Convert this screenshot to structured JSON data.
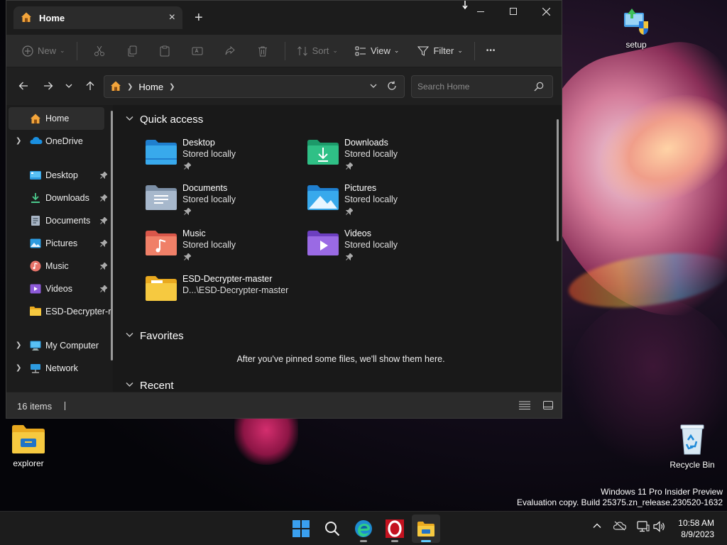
{
  "desktop": {
    "icons": [
      {
        "label": "setup"
      },
      {
        "label": "explorer"
      },
      {
        "label": "Recycle Bin"
      }
    ],
    "watermark_line1": "Windows 11 Pro Insider Preview",
    "watermark_line2": "Evaluation copy. Build 25375.zn_release.230520-1632"
  },
  "window": {
    "tab_title": "Home",
    "tab_close": "×",
    "new_tab": "+",
    "controls": {
      "minimize": "─",
      "maximize": "☐",
      "close": "✕"
    },
    "toolbar": {
      "new_label": "New",
      "sort_label": "Sort",
      "view_label": "View",
      "filter_label": "Filter",
      "more_label": "•••"
    },
    "address": {
      "crumbs": [
        "Home"
      ],
      "search_placeholder": "Search Home"
    },
    "nav": {
      "items": [
        {
          "label": "Home",
          "icon": "home-icon",
          "selected": true
        },
        {
          "label": "OneDrive",
          "icon": "onedrive-icon",
          "expandable": true
        },
        {
          "label": "Desktop",
          "icon": "desktop-folder-icon",
          "pinned": true
        },
        {
          "label": "Downloads",
          "icon": "downloads-folder-icon",
          "pinned": true
        },
        {
          "label": "Documents",
          "icon": "documents-folder-icon",
          "pinned": true
        },
        {
          "label": "Pictures",
          "icon": "pictures-folder-icon",
          "pinned": true
        },
        {
          "label": "Music",
          "icon": "music-folder-icon",
          "pinned": true
        },
        {
          "label": "Videos",
          "icon": "videos-folder-icon",
          "pinned": true
        },
        {
          "label": "ESD-Decrypter-r",
          "icon": "folder-icon"
        },
        {
          "label": "My Computer",
          "icon": "computer-icon",
          "expandable": true
        },
        {
          "label": "Network",
          "icon": "network-icon",
          "expandable": true
        }
      ]
    },
    "content": {
      "quick_access_title": "Quick access",
      "favorites_title": "Favorites",
      "recent_title": "Recent",
      "favorites_empty": "After you've pinned some files, we'll show them here.",
      "quick_access": [
        {
          "name": "Desktop",
          "sub": "Stored locally",
          "icon": "desktop-folder-icon",
          "pinned": true
        },
        {
          "name": "Downloads",
          "sub": "Stored locally",
          "icon": "downloads-folder-icon",
          "pinned": true
        },
        {
          "name": "Documents",
          "sub": "Stored locally",
          "icon": "documents-folder-icon",
          "pinned": true
        },
        {
          "name": "Pictures",
          "sub": "Stored locally",
          "icon": "pictures-folder-icon",
          "pinned": true
        },
        {
          "name": "Music",
          "sub": "Stored locally",
          "icon": "music-folder-icon",
          "pinned": true
        },
        {
          "name": "Videos",
          "sub": "Stored locally",
          "icon": "videos-folder-icon",
          "pinned": true
        },
        {
          "name": "ESD-Decrypter-master",
          "sub": "D...\\ESD-Decrypter-master",
          "icon": "folder-icon",
          "pinned": false
        }
      ]
    },
    "status": {
      "items_count": "16 items"
    }
  },
  "taskbar": {
    "apps": [
      "start-icon",
      "search-icon",
      "edge-icon",
      "opera-icon",
      "file-explorer-icon"
    ],
    "active_app": "file-explorer-icon",
    "clock_time": "10:58 AM",
    "clock_date": "8/9/2023"
  },
  "colors": {
    "window_bg": "#202020",
    "toolbar_bg": "#2b2b2b",
    "accent": "#60cdff",
    "folder_yellow": "#f5c746"
  }
}
